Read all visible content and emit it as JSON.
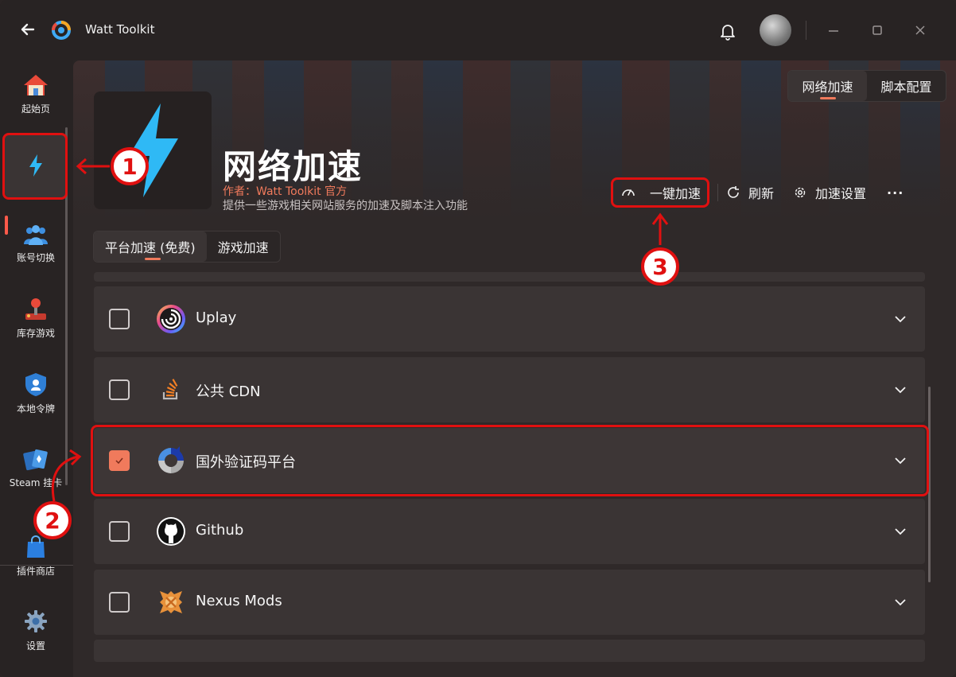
{
  "window": {
    "title": "Watt Toolkit"
  },
  "sidebar": {
    "items": [
      {
        "label": "起始页",
        "icon": "home-icon"
      },
      {
        "label": "",
        "icon": "lightning-icon",
        "active": true
      },
      {
        "label": "账号切换",
        "icon": "users-icon"
      },
      {
        "label": "库存游戏",
        "icon": "joystick-icon"
      },
      {
        "label": "本地令牌",
        "icon": "shield-icon"
      },
      {
        "label": "Steam 挂卡",
        "icon": "cards-icon"
      },
      {
        "label": "插件商店",
        "icon": "shopping-bag-icon"
      },
      {
        "label": "设置",
        "icon": "gear-icon"
      }
    ]
  },
  "top_tabs": [
    {
      "label": "网络加速",
      "active": true
    },
    {
      "label": "脚本配置",
      "active": false
    }
  ],
  "plugin": {
    "title": "网络加速",
    "author": "作者：Watt Toolkit  官方",
    "description": "提供一些游戏相关网站服务的加速及脚本注入功能"
  },
  "actions": {
    "one_click": "一键加速",
    "refresh": "刷新",
    "settings": "加速设置",
    "more": "···"
  },
  "sub_tabs": [
    {
      "label": "平台加速 (免费)",
      "active": true
    },
    {
      "label": "游戏加速",
      "active": false
    }
  ],
  "services": [
    {
      "name": "Uplay",
      "checked": false,
      "icon": "uplay-icon"
    },
    {
      "name": "公共 CDN",
      "checked": false,
      "icon": "stackoverflow-icon"
    },
    {
      "name": "国外验证码平台",
      "checked": true,
      "icon": "recaptcha-icon"
    },
    {
      "name": "Github",
      "checked": false,
      "icon": "github-icon"
    },
    {
      "name": "Nexus Mods",
      "checked": false,
      "icon": "nexus-icon"
    }
  ],
  "annotations": [
    "1",
    "2",
    "3"
  ],
  "colors": {
    "accent": "#f07a5c",
    "highlight": "#e01010",
    "lightning": "#2fb9f5"
  }
}
